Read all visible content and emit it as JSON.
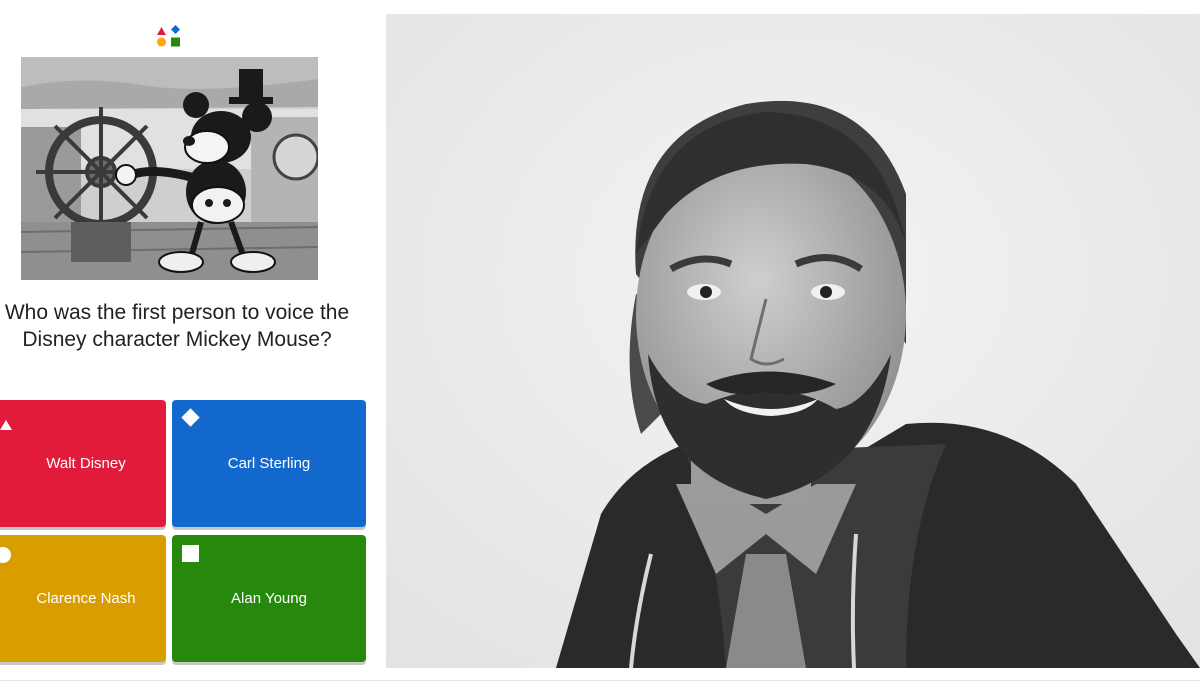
{
  "quiz": {
    "question": "Who was the first person to voice the Disney character Mickey Mouse?",
    "answers": [
      {
        "label": "Walt Disney",
        "color": "#e21b3c",
        "shape": "triangle-icon"
      },
      {
        "label": "Carl Sterling",
        "color": "#1368ce",
        "shape": "diamond-icon"
      },
      {
        "label": "Clarence Nash",
        "color": "#d89e00",
        "shape": "circle-icon"
      },
      {
        "label": "Alan Young",
        "color": "#26890c",
        "shape": "square-icon"
      }
    ],
    "logo_colors": [
      "#e21b3c",
      "#1368ce",
      "#ffa602",
      "#26890c"
    ]
  },
  "colors": {
    "background": "#ffffff",
    "text": "#222222"
  }
}
